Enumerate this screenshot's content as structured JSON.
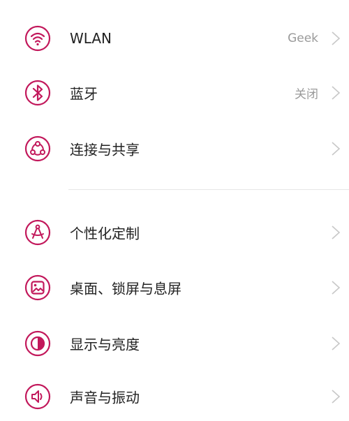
{
  "accent_color": "#c2185b",
  "settings": {
    "group1": [
      {
        "label": "WLAN",
        "value": "Geek",
        "icon": "wifi-icon"
      },
      {
        "label": "蓝牙",
        "value": "关闭",
        "icon": "bluetooth-icon"
      },
      {
        "label": "连接与共享",
        "value": "",
        "icon": "share-icon"
      }
    ],
    "group2": [
      {
        "label": "个性化定制",
        "value": "",
        "icon": "personalize-icon"
      },
      {
        "label": "桌面、锁屏与息屏",
        "value": "",
        "icon": "wallpaper-icon"
      },
      {
        "label": "显示与亮度",
        "value": "",
        "icon": "brightness-icon"
      },
      {
        "label": "声音与振动",
        "value": "",
        "icon": "sound-icon"
      }
    ]
  }
}
